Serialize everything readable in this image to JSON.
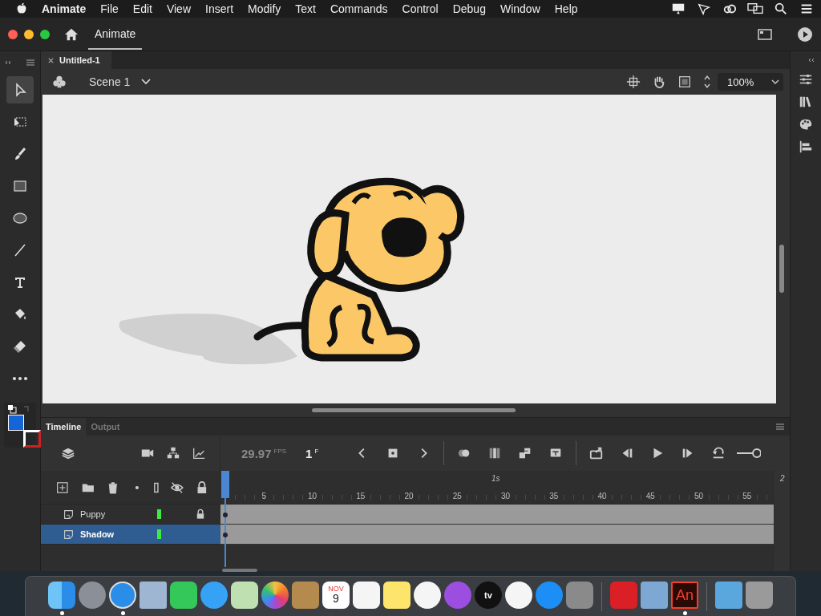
{
  "menu_bar": {
    "app": "Animate",
    "items": [
      "File",
      "Edit",
      "View",
      "Insert",
      "Modify",
      "Text",
      "Commands",
      "Control",
      "Debug",
      "Window",
      "Help"
    ]
  },
  "title_bar": {
    "tabs": [
      {
        "label": "Animate",
        "selected": true
      }
    ]
  },
  "document_tabs": [
    {
      "label": "Untitled-1",
      "selected": true
    }
  ],
  "scene_bar": {
    "scene": "Scene 1",
    "zoom": "100%"
  },
  "tools": [
    {
      "kind": "select",
      "selected": true
    },
    {
      "kind": "transform",
      "selected": false
    },
    {
      "kind": "brush",
      "selected": false
    },
    {
      "kind": "rectangle",
      "selected": false
    },
    {
      "kind": "oval",
      "selected": false
    },
    {
      "kind": "line",
      "selected": false
    },
    {
      "kind": "text",
      "selected": false
    },
    {
      "kind": "bucket",
      "selected": false
    },
    {
      "kind": "eraser",
      "selected": false
    },
    {
      "kind": "more",
      "selected": false
    }
  ],
  "fill_color": {
    "color": "#1565d8"
  },
  "timeline": {
    "tabs": [
      {
        "label": "Timeline",
        "selected": true
      },
      {
        "label": "Output",
        "selected": false
      }
    ],
    "fps": "29.97",
    "fps_unit": "FPS",
    "frame": "1",
    "frame_unit": "F",
    "time_marks": [
      "1s",
      "2"
    ],
    "frame_numbers": [
      "5",
      "10",
      "15",
      "20",
      "25",
      "30",
      "35",
      "40",
      "45",
      "50",
      "55"
    ],
    "layers": [
      {
        "name": "Puppy",
        "locked": true,
        "selected": false
      },
      {
        "name": "Shadow",
        "locked": false,
        "selected": true
      }
    ]
  },
  "dock": [
    {
      "kind": "finder",
      "running": true
    },
    {
      "kind": "launchpad",
      "running": false
    },
    {
      "kind": "safari",
      "running": true
    },
    {
      "kind": "mail",
      "running": false
    },
    {
      "kind": "facetime",
      "running": false
    },
    {
      "kind": "messages",
      "running": false
    },
    {
      "kind": "maps",
      "running": false
    },
    {
      "kind": "photos",
      "running": false
    },
    {
      "kind": "contacts",
      "running": false
    },
    {
      "kind": "calendar",
      "running": false,
      "month": "NOV",
      "text": "9"
    },
    {
      "kind": "reminders",
      "running": false
    },
    {
      "kind": "notes",
      "running": false
    },
    {
      "kind": "music",
      "running": false
    },
    {
      "kind": "podcasts",
      "running": false
    },
    {
      "kind": "tv",
      "running": false,
      "text": "tv"
    },
    {
      "kind": "news",
      "running": false
    },
    {
      "kind": "appstore",
      "running": false
    },
    {
      "kind": "preferences",
      "running": false
    },
    {
      "kind": "separator"
    },
    {
      "kind": "creativecloud",
      "running": false
    },
    {
      "kind": "preview",
      "running": false
    },
    {
      "kind": "animate",
      "running": true,
      "text": "An"
    },
    {
      "kind": "separator"
    },
    {
      "kind": "downloads",
      "running": false
    },
    {
      "kind": "trash",
      "running": false
    }
  ]
}
